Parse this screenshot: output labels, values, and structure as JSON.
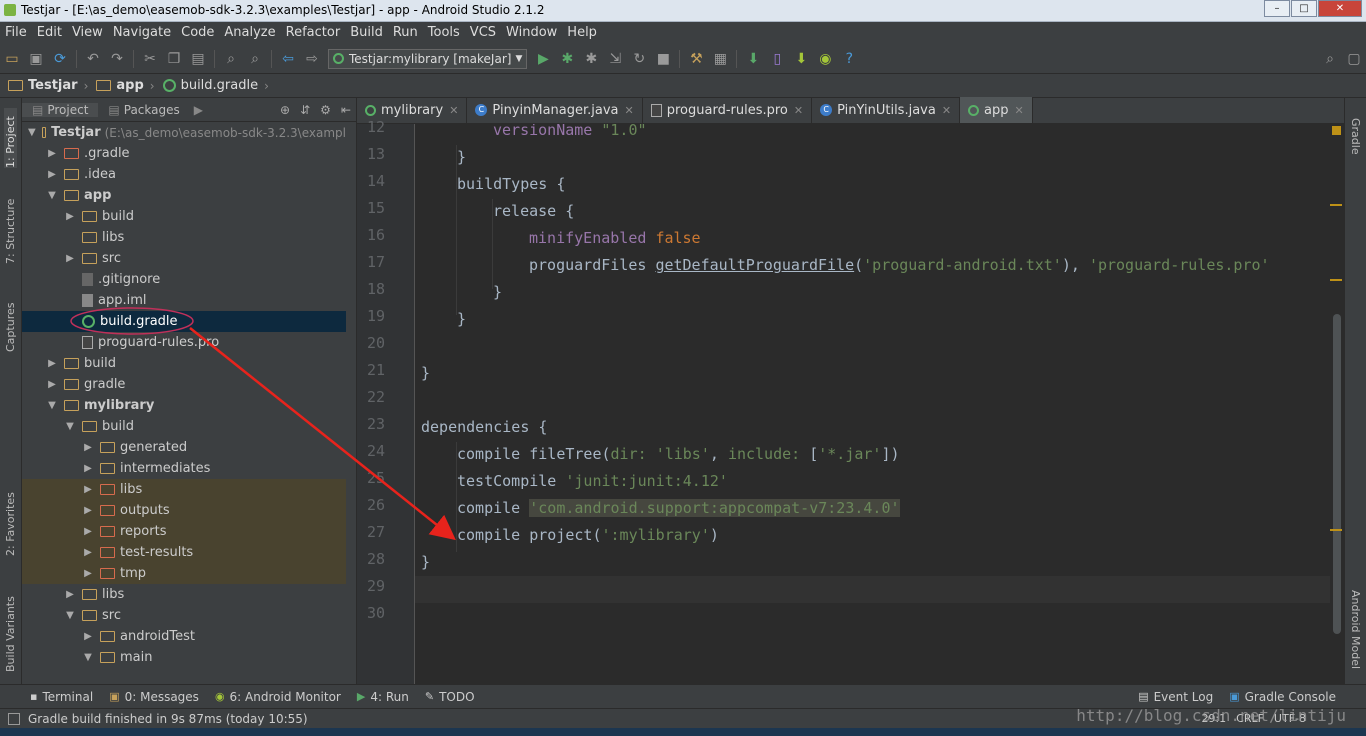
{
  "window": {
    "title": "Testjar - [E:\\as_demo\\easemob-sdk-3.2.3\\examples\\Testjar] - app - Android Studio 2.1.2"
  },
  "menu": [
    "File",
    "Edit",
    "View",
    "Navigate",
    "Code",
    "Analyze",
    "Refactor",
    "Build",
    "Run",
    "Tools",
    "VCS",
    "Window",
    "Help"
  ],
  "toolbar": {
    "run_config": "Testjar:mylibrary [makeJar]"
  },
  "breadcrumb": [
    "Testjar",
    "app",
    "build.gradle"
  ],
  "left_strip": {
    "project": "1: Project",
    "structure": "7: Structure",
    "captures": "Captures",
    "favorites": "2: Favorites",
    "variants": "Build Variants"
  },
  "right_strip": {
    "gradle": "Gradle",
    "android_model": "Android Model"
  },
  "project_panel": {
    "tab_project": "Project",
    "tab_packages": "Packages",
    "root_label": "Testjar",
    "root_path": "(E:\\as_demo\\easemob-sdk-3.2.3\\exampl",
    "nodes": [
      ".gradle",
      ".idea",
      "app",
      "build",
      "libs",
      "src",
      ".gitignore",
      "app.iml",
      "build.gradle",
      "proguard-rules.pro",
      "build",
      "gradle",
      "mylibrary",
      "build",
      "generated",
      "intermediates",
      "libs",
      "outputs",
      "reports",
      "test-results",
      "tmp",
      "libs",
      "src",
      "androidTest",
      "main"
    ]
  },
  "editor_tabs": [
    "mylibrary",
    "PinyinManager.java",
    "proguard-rules.pro",
    "PinYinUtils.java",
    "app"
  ],
  "line_numbers": [
    "12",
    "13",
    "14",
    "15",
    "16",
    "17",
    "18",
    "19",
    "20",
    "21",
    "22",
    "23",
    "24",
    "25",
    "26",
    "27",
    "28",
    "29",
    "30"
  ],
  "code": {
    "l12_a": "versionName ",
    "l12_b": "\"1.0\"",
    "l13": "}",
    "l14": "buildTypes {",
    "l15": "release {",
    "l16_a": "minifyEnabled ",
    "l16_b": "false",
    "l17_a": "proguardFiles ",
    "l17_b": "getDefaultProguardFile",
    "l17_c": "(",
    "l17_d": "'proguard-android.txt'",
    "l17_e": "), ",
    "l17_f": "'proguard-rules.pro'",
    "l18": "}",
    "l19": "}",
    "l21": "}",
    "l23": "dependencies {",
    "l24_a": "compile fileTree(",
    "l24_b": "dir: ",
    "l24_c": "'libs'",
    "l24_d": ", ",
    "l24_e": "include: ",
    "l24_f": "[",
    "l24_g": "'*.jar'",
    "l24_h": "])",
    "l25_a": "testCompile ",
    "l25_b": "'junit:junit:4.12'",
    "l26_a": "compile ",
    "l26_b": "'com.android.support:appcompat-v7:23.4.0'",
    "l27_a": "compile project(",
    "l27_b": "':mylibrary'",
    "l27_c": ")",
    "l28": "}"
  },
  "tool_windows": {
    "terminal": "Terminal",
    "messages": "0: Messages",
    "monitor": "6: Android Monitor",
    "run": "4: Run",
    "todo": "TODO",
    "event_log": "Event Log",
    "gradle_console": "Gradle Console"
  },
  "status": {
    "message": "Gradle build finished in 9s 87ms (today 10:55)",
    "position": "29:1",
    "line_sep": "CRLF",
    "encoding": "UTF-8"
  },
  "watermark": "http://blog.csdn.net/lintiju",
  "colors": {
    "keyword": "#cc7832",
    "string": "#6a8759",
    "property": "#9876aa",
    "annotation_arrow": "#e8231c",
    "selection": "#0d293e"
  }
}
